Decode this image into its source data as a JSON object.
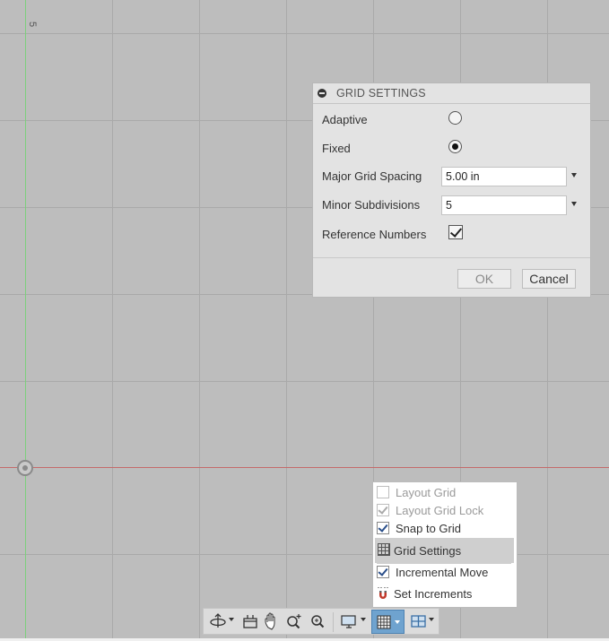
{
  "viewport": {
    "grid_scale_label": "5",
    "colors": {
      "background": "#bdbdbd",
      "grid_line": "#a9a9a9",
      "x_axis": "#c46a6a",
      "y_axis": "#7ccf7c"
    }
  },
  "dialog": {
    "title": "GRID SETTINGS",
    "collapse_icon": "collapse-icon",
    "rows": {
      "adaptive": {
        "label": "Adaptive",
        "selected": false
      },
      "fixed": {
        "label": "Fixed",
        "selected": true
      },
      "major_spacing": {
        "label": "Major Grid Spacing",
        "value": "5.00 in"
      },
      "minor_subdivisions": {
        "label": "Minor Subdivisions",
        "value": "5"
      },
      "reference_numbers": {
        "label": "Reference Numbers",
        "checked": true
      }
    },
    "buttons": {
      "ok": "OK",
      "cancel": "Cancel"
    }
  },
  "grid_menu": {
    "items": [
      {
        "label": "Layout Grid",
        "checked": false,
        "disabled": true
      },
      {
        "label": "Layout Grid Lock",
        "checked": true,
        "disabled": true
      },
      {
        "label": "Snap to Grid",
        "checked": true,
        "disabled": false
      },
      {
        "label": "Grid Settings",
        "icon": "grid-icon",
        "highlighted": true
      },
      {
        "label": "Incremental Move",
        "checked": true,
        "disabled": false
      },
      {
        "label": "Set Increments",
        "icon": "magnet-icon"
      }
    ]
  },
  "toolbar": {
    "buttons": [
      {
        "icon": "orbit-icon",
        "has_dropdown": true
      },
      {
        "icon": "look-at-icon"
      },
      {
        "icon": "pan-icon"
      },
      {
        "icon": "zoom-icon"
      },
      {
        "icon": "fit-icon"
      },
      {
        "icon": "display-settings-icon",
        "has_dropdown": true
      },
      {
        "icon": "grid-snaps-icon",
        "has_dropdown": true,
        "active": true
      },
      {
        "icon": "viewports-icon",
        "has_dropdown": true
      }
    ]
  }
}
